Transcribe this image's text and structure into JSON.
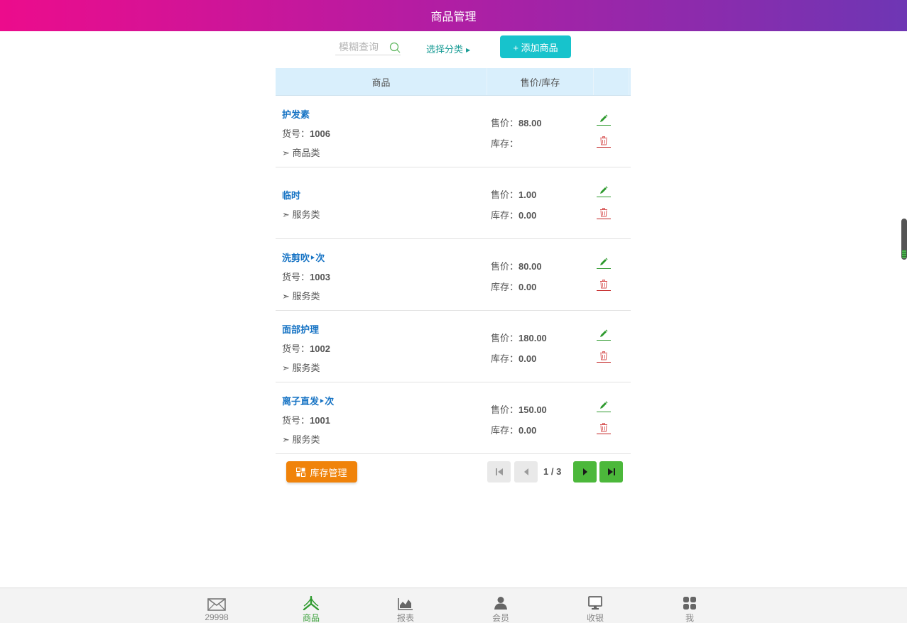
{
  "header": {
    "title": "商品管理"
  },
  "toolbar": {
    "search_placeholder": "模糊查询",
    "category_label": "选择分类",
    "add_label": "+ 添加商品"
  },
  "table": {
    "columns": [
      "商品",
      "售价/库存",
      ""
    ],
    "price_prefix": "售价：",
    "stock_prefix": "库存：",
    "sku_prefix": "货号：",
    "rows": [
      {
        "name": "护发素",
        "sku": "1006",
        "category": "➣ 商品类",
        "price": "88.00",
        "stock": ""
      },
      {
        "name": "临时",
        "sku": "",
        "category": "➣ 服务类",
        "price": "1.00",
        "stock": "0.00"
      },
      {
        "name": "洗剪吹‣次",
        "sku": "1003",
        "category": "➣ 服务类",
        "price": "80.00",
        "stock": "0.00"
      },
      {
        "name": "面部护理",
        "sku": "1002",
        "category": "➣ 服务类",
        "price": "180.00",
        "stock": "0.00"
      },
      {
        "name": "离子直发‣次",
        "sku": "1001",
        "category": "➣ 服务类",
        "price": "150.00",
        "stock": "0.00"
      }
    ]
  },
  "footer": {
    "stock_manage_label": "库存管理",
    "page_info": "1 / 3"
  },
  "tabbar": {
    "items": [
      {
        "label": "29998",
        "icon": "mail-icon",
        "active": false
      },
      {
        "label": "商品",
        "icon": "goods-icon",
        "active": true
      },
      {
        "label": "报表",
        "icon": "chart-icon",
        "active": false
      },
      {
        "label": "会员",
        "icon": "member-icon",
        "active": false
      },
      {
        "label": "收银",
        "icon": "monitor-icon",
        "active": false
      },
      {
        "label": "我",
        "icon": "apps-icon",
        "active": false
      }
    ]
  },
  "colors": {
    "header_gradient": [
      "#ec0c8c",
      "#6e36b4"
    ],
    "accent_teal": "#17c3cc",
    "link_blue": "#1673c4",
    "green": "#4cb83b",
    "orange": "#f0830a",
    "danger": "#c32323"
  }
}
